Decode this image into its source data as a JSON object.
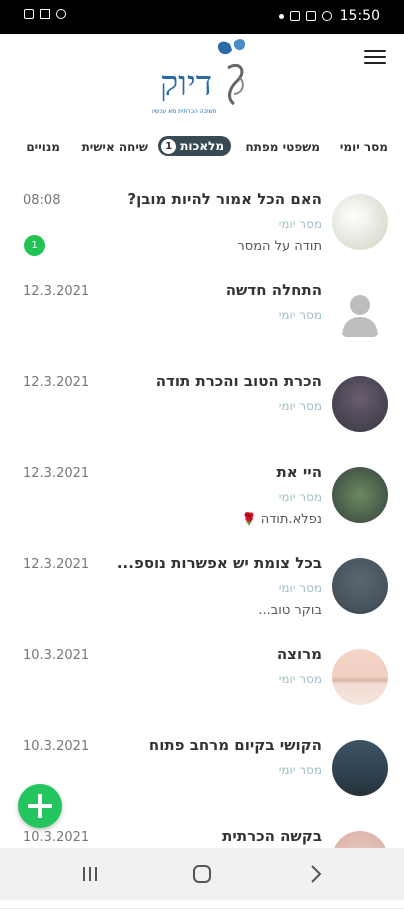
{
  "status_bar": {
    "time": "15:50"
  },
  "app": {
    "logo_text": "דיוק",
    "logo_tagline": "חשיבה הכרתית מא עכשיו",
    "colors": {
      "brand": "#2a6aa6",
      "accent_green": "#23c353",
      "subtitle": "#9fc0c8"
    }
  },
  "tabs": [
    {
      "label": "מסר יומי"
    },
    {
      "label": "משפטי מפתח"
    },
    {
      "label": "מלאכות",
      "badge": "1",
      "active": true
    },
    {
      "label": "שיחה אישית"
    },
    {
      "label": "מנויים"
    }
  ],
  "messages": [
    {
      "title": "האם הכל אמור להיות מובן?",
      "subtitle": "מסר יומי",
      "snippet": "תודה על המסר",
      "date": "08:08",
      "unread": "1"
    },
    {
      "title": "התחלה חדשה",
      "subtitle": "מסר יומי",
      "snippet": "",
      "date": "12.3.2021"
    },
    {
      "title": "הכרת הטוב והכרת תודה",
      "subtitle": "מסר יומי",
      "snippet": "",
      "date": "12.3.2021"
    },
    {
      "title": "היי את",
      "subtitle": "מסר יומי",
      "snippet": "נפלא.תודה",
      "date": "12.3.2021",
      "icon": "rose-icon"
    },
    {
      "title": "בכל צומת יש אפשרות נוספ...",
      "subtitle": "מסר יומי",
      "snippet": "בוקר טוב...",
      "date": "12.3.2021"
    },
    {
      "title": "מרוצה",
      "subtitle": "מסר יומי",
      "snippet": "",
      "date": "10.3.2021"
    },
    {
      "title": "הקושי בקיום מרחב פתוח",
      "subtitle": "מסר יומי",
      "snippet": "",
      "date": "10.3.2021"
    },
    {
      "title": "בקשה הכרתית",
      "subtitle": "",
      "snippet": "",
      "date": "10.3.2021"
    }
  ]
}
